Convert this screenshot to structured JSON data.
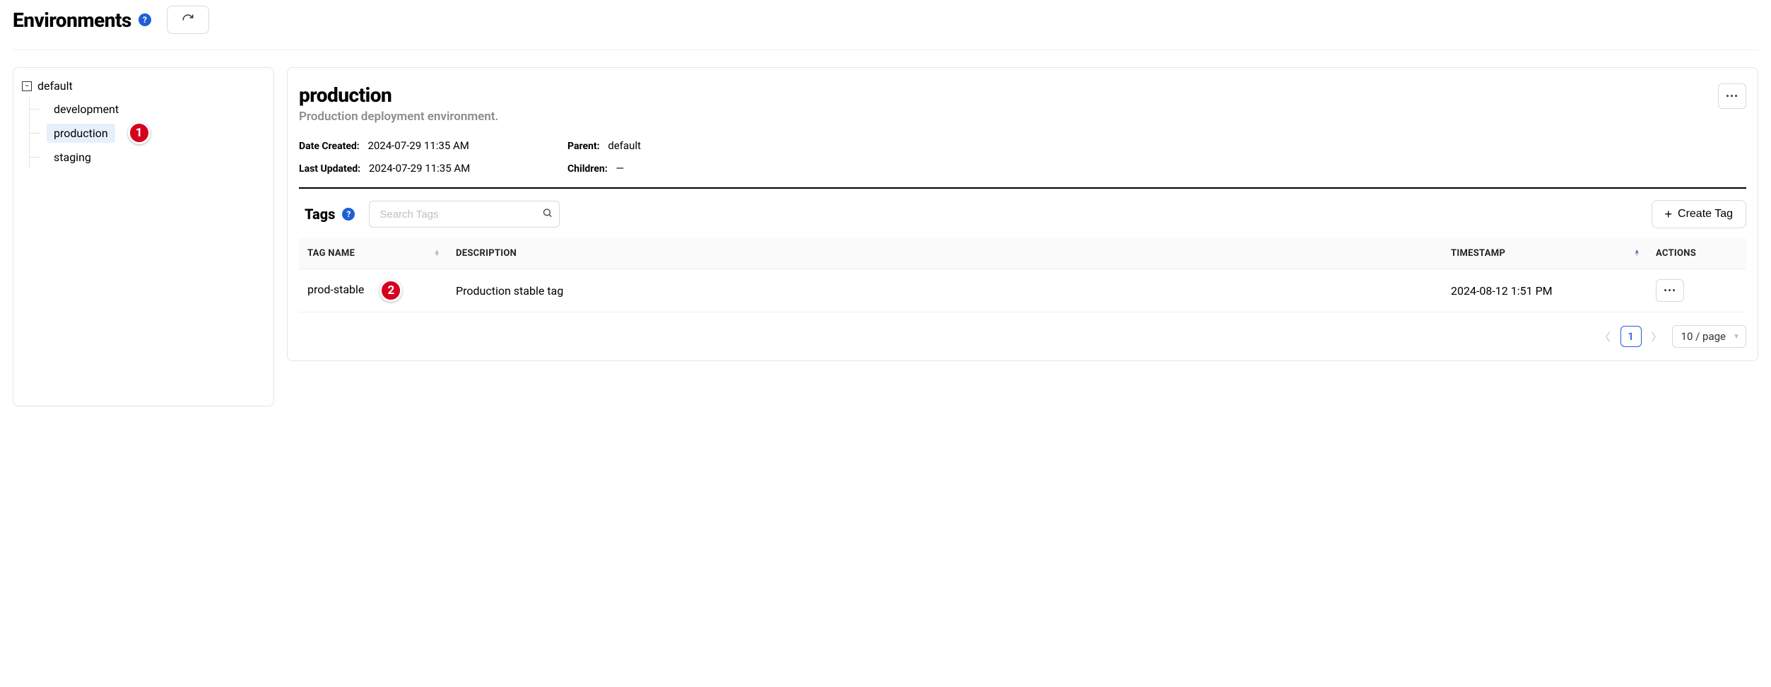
{
  "header": {
    "title": "Environments"
  },
  "tree": {
    "root_label": "default",
    "children": [
      {
        "label": "development",
        "selected": false
      },
      {
        "label": "production",
        "selected": true
      },
      {
        "label": "staging",
        "selected": false
      }
    ]
  },
  "detail": {
    "title": "production",
    "subtitle": "Production deployment environment.",
    "meta": {
      "date_created_label": "Date Created:",
      "date_created_value": "2024-07-29 11:35 AM",
      "last_updated_label": "Last Updated:",
      "last_updated_value": "2024-07-29 11:35 AM",
      "parent_label": "Parent:",
      "parent_value": "default",
      "children_label": "Children:",
      "children_value": "—"
    }
  },
  "tags": {
    "section_title": "Tags",
    "search_placeholder": "Search Tags",
    "create_button": "Create Tag",
    "columns": {
      "tag_name": "TAG NAME",
      "description": "DESCRIPTION",
      "timestamp": "TIMESTAMP",
      "actions": "ACTIONS"
    },
    "rows": [
      {
        "name": "prod-stable",
        "description": "Production stable tag",
        "timestamp": "2024-08-12 1:51 PM"
      }
    ]
  },
  "pagination": {
    "current_page": "1",
    "page_size_label": "10 / page"
  },
  "callouts": {
    "one": "1",
    "two": "2"
  }
}
